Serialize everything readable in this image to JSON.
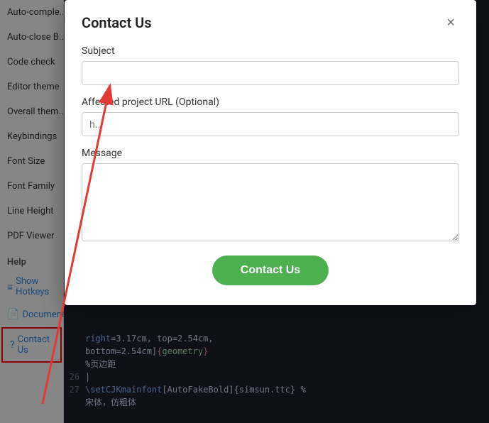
{
  "sidebar": {
    "items": [
      {
        "label": "Auto-comple...",
        "id": "auto-complete"
      },
      {
        "label": "Auto-close B...",
        "id": "auto-close-brackets"
      },
      {
        "label": "Code check",
        "id": "code-check"
      },
      {
        "label": "Editor theme",
        "id": "editor-theme"
      },
      {
        "label": "Overall them...",
        "id": "overall-theme"
      },
      {
        "label": "Keybindings",
        "id": "keybindings"
      },
      {
        "label": "Font Size",
        "id": "font-size"
      },
      {
        "label": "Font Family",
        "id": "font-family"
      },
      {
        "label": "Line Height",
        "id": "line-height"
      },
      {
        "label": "PDF Viewer",
        "id": "pdf-viewer"
      }
    ],
    "section_help": "Help",
    "links": [
      {
        "label": "Show Hotkeys",
        "icon": "≡",
        "id": "show-hotkeys"
      },
      {
        "label": "Documentation",
        "icon": "📄",
        "id": "documentation"
      },
      {
        "label": "Contact Us",
        "icon": "?",
        "id": "contact-us",
        "highlighted": true
      }
    ]
  },
  "modal": {
    "title": "Contact Us",
    "close_label": "×",
    "subject_label": "Subject",
    "subject_placeholder": "",
    "affected_url_label": "Affected project URL (Optional)",
    "affected_url_placeholder": "h...",
    "message_label": "Message",
    "message_placeholder": "",
    "submit_label": "Contact Us"
  },
  "editor": {
    "lines": [
      {
        "number": "",
        "content": "right=3.17cm, top=2.54cm,"
      },
      {
        "number": "",
        "content": "bottom=2.54cm]{geometry}"
      },
      {
        "number": "",
        "content": "%页边距"
      },
      {
        "number": "26",
        "content": "|"
      },
      {
        "number": "27",
        "content": "\\setCJKmainfont[AutoFakeBold]{simsun.ttc} %"
      },
      {
        "number": "",
        "content": "宋体，仿粗体"
      }
    ]
  },
  "colors": {
    "accent_green": "#4caf50",
    "sidebar_bg": "#f5f5f5",
    "editor_bg": "#1e1e2e",
    "modal_bg": "#ffffff",
    "arrow_red": "#e53935"
  }
}
